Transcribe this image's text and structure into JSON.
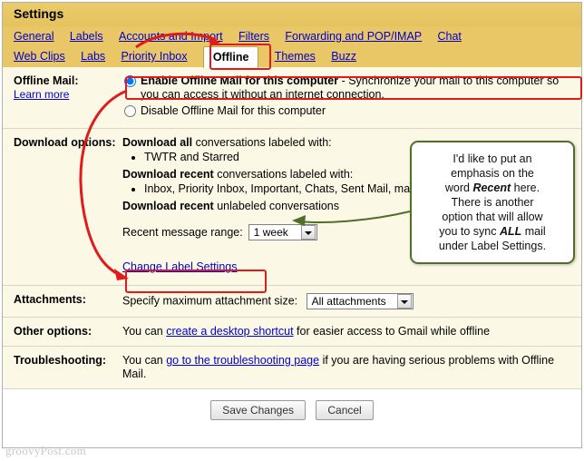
{
  "header": {
    "title": "Settings"
  },
  "tabs_row1": [
    {
      "label": "General",
      "selected": false
    },
    {
      "label": "Labels",
      "selected": false
    },
    {
      "label": "Accounts and Import",
      "selected": false
    },
    {
      "label": "Filters",
      "selected": false
    },
    {
      "label": "Forwarding and POP/IMAP",
      "selected": false
    },
    {
      "label": "Chat",
      "selected": false
    }
  ],
  "tabs_row2": [
    {
      "label": "Web Clips",
      "selected": false
    },
    {
      "label": "Labs",
      "selected": false
    },
    {
      "label": "Priority Inbox",
      "selected": false
    },
    {
      "label": "Offline",
      "selected": true
    },
    {
      "label": "Themes",
      "selected": false
    },
    {
      "label": "Buzz",
      "selected": false
    }
  ],
  "rows": {
    "offline_mail": {
      "label": "Offline Mail:",
      "learn_more": "Learn more",
      "enable_label_bold": "Enable Offline Mail for this computer",
      "enable_label_rest": " - Synchronize your mail to this computer so you can access it without an internet connection.",
      "disable_label": "Disable Offline Mail for this computer",
      "enable_checked": true
    },
    "download_options": {
      "label": "Download options:",
      "download_all_bold": "Download all",
      "download_all_rest": " conversations labeled with:",
      "download_all_items": [
        "TWTR and Starred"
      ],
      "download_recent_bold": "Download recent",
      "download_recent_rest": " conversations labeled with:",
      "download_recent_items": [
        "Inbox, Priority Inbox, Important, Chats, Sent Mail, mail and SU.PR"
      ],
      "download_unlabeled_bold": "Download recent",
      "download_unlabeled_rest": " unlabeled conversations",
      "range_label": "Recent message range:",
      "range_value": "1 week",
      "change_label_settings": "Change Label Settings"
    },
    "attachments": {
      "label": "Attachments:",
      "text": "Specify maximum attachment size:",
      "select_value": "All attachments"
    },
    "other_options": {
      "label": "Other options:",
      "pre": "You can ",
      "link": "create a desktop shortcut",
      "post": " for easier access to Gmail while offline"
    },
    "troubleshooting": {
      "label": "Troubleshooting:",
      "pre": "You can ",
      "link": "go to the troubleshooting page",
      "post": " if you are having serious problems with Offline Mail."
    }
  },
  "footer": {
    "save_label": "Save Changes",
    "cancel_label": "Cancel"
  },
  "callout": {
    "line1": "I'd like to put an",
    "line2": "emphasis on the",
    "line3_pre": "word ",
    "line3_em": "Recent",
    "line3_post": " here.",
    "line4": "There is another",
    "line5": "option that will allow",
    "line6_pre": "you to sync ",
    "line6_em": "ALL",
    "line6_post": " mail",
    "line7": "under Label Settings."
  },
  "watermark": "groovyPost.com",
  "colors": {
    "accent": "#e8c96a",
    "annotation_red": "#e01b1b",
    "annotation_green": "#4f6f2a",
    "link": "#0000cc"
  }
}
